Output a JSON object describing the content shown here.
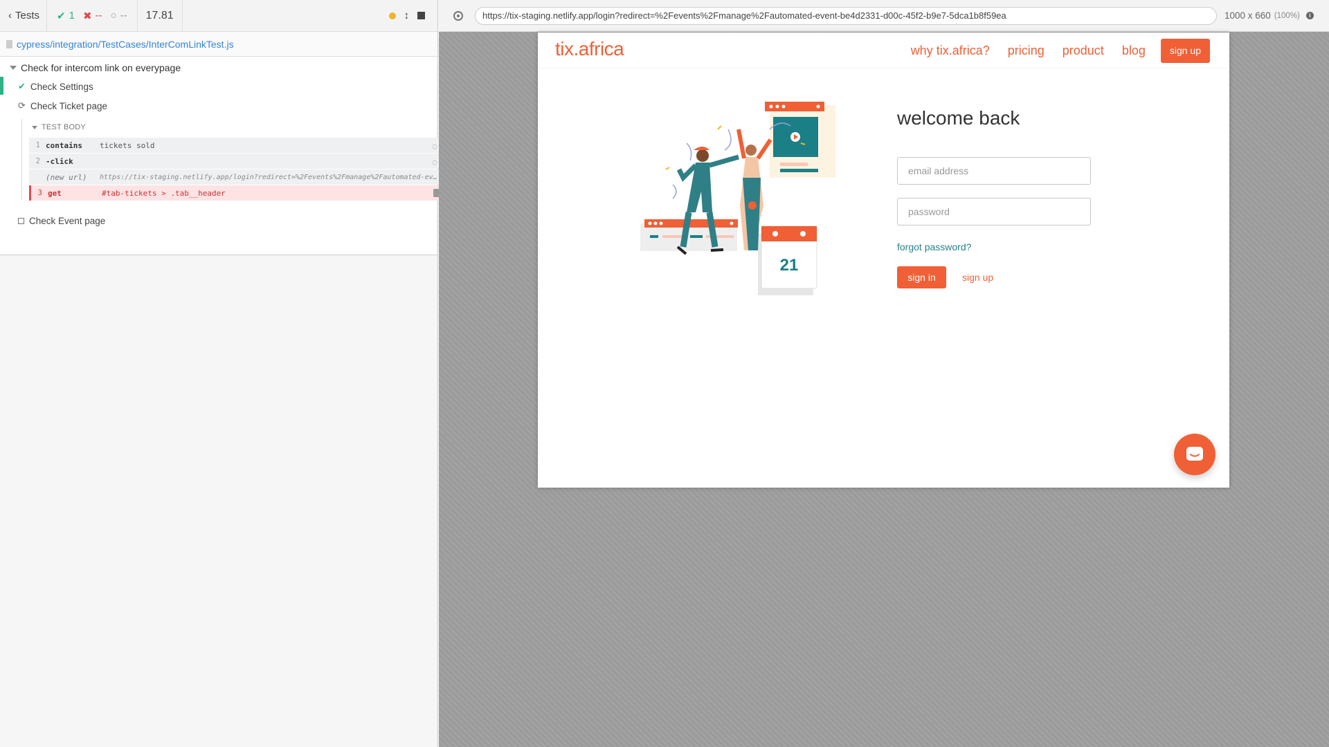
{
  "reporter": {
    "tests_label": "Tests",
    "passed_count": "1",
    "failed_count": "--",
    "pending_count": "--",
    "duration": "17.81",
    "spec_path": "cypress/integration/TestCases/InterComLinkTest.js",
    "suite_title": "Check for intercom link on everypage",
    "tests": [
      {
        "title": "Check Settings",
        "state": "passed"
      },
      {
        "title": "Check Ticket page",
        "state": "running"
      },
      {
        "title": "Check Event page",
        "state": "pending"
      }
    ],
    "test_body_label": "TEST BODY",
    "commands": [
      {
        "num": "1",
        "name": "contains",
        "message": "tickets sold"
      },
      {
        "num": "2",
        "name": "-click",
        "message": ""
      },
      {
        "num": "",
        "name": "(new url)",
        "message": "https://tix-staging.netlify.app/login?redirect=%2Fevents%2Fmanage%2Fautomated-ev…"
      },
      {
        "num": "3",
        "name": "get",
        "message": "#tab-tickets > .tab__header"
      }
    ],
    "colors": {
      "pass": "#2db384",
      "fail": "#e0484e",
      "running": "#f0b429"
    }
  },
  "aut": {
    "url": "https://tix-staging.netlify.app/login?redirect=%2Fevents%2Fmanage%2Fautomated-event-be4d2331-d00c-45f2-b9e7-5dca1b8f59ea",
    "viewport": "1000 x 660",
    "zoom": "(100%)"
  },
  "app": {
    "brand": "tix.africa",
    "nav": [
      "why tix.africa?",
      "pricing",
      "product",
      "blog"
    ],
    "nav_signup": "sign up",
    "welcome": "welcome back",
    "email_placeholder": "email address",
    "password_placeholder": "password",
    "forgot": "forgot password?",
    "signin": "sign in",
    "signup": "sign up",
    "calendar_day": "21",
    "accent": "#f05f35",
    "teal": "#26818a"
  }
}
